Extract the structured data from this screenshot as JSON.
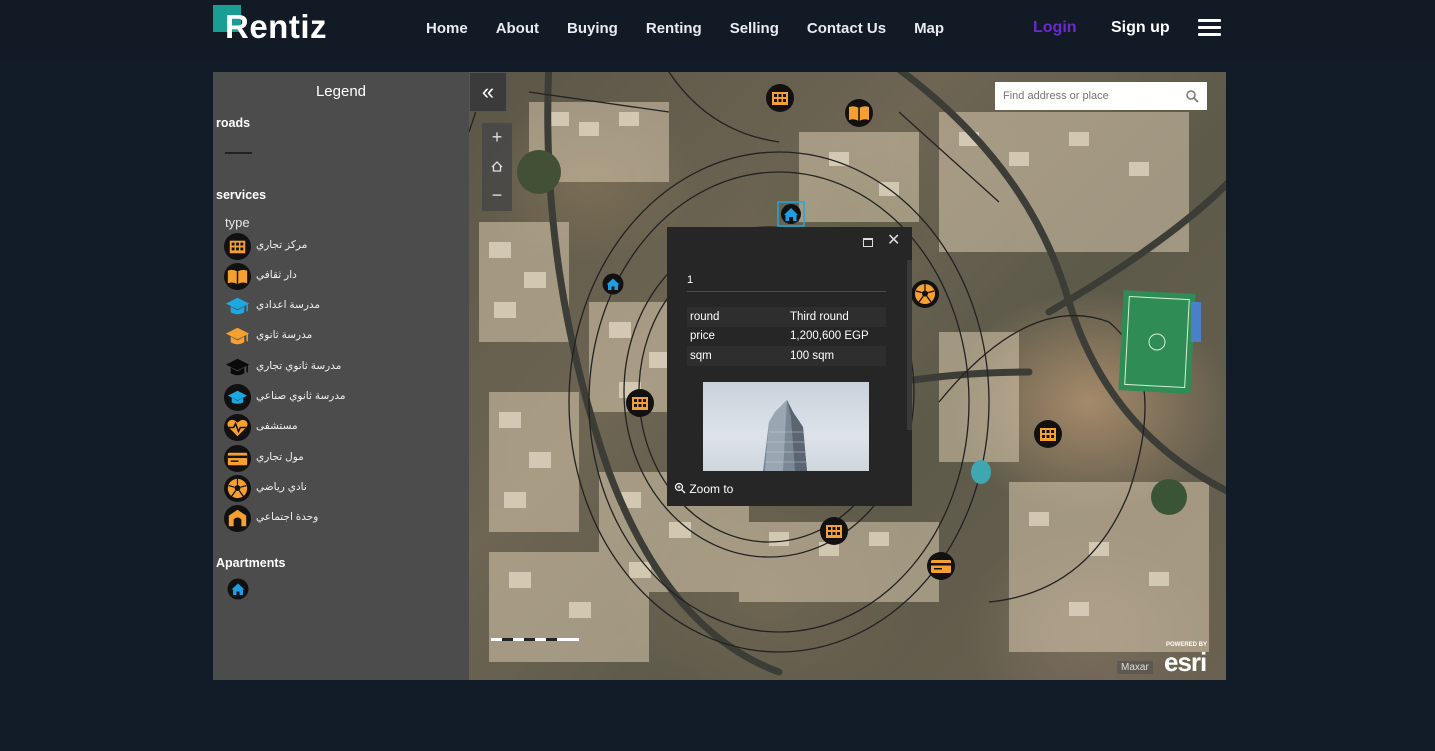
{
  "brand": {
    "name": "Rentiz",
    "accent": "#1a9e94"
  },
  "nav": {
    "links": [
      "Home",
      "About",
      "Buying",
      "Renting",
      "Selling",
      "Contact Us",
      "Map"
    ],
    "login": "Login",
    "signup": "Sign up",
    "login_color": "#6a2ad0",
    "menu_icon": "hamburger-icon"
  },
  "legend": {
    "title": "Legend",
    "roads_heading": "roads",
    "services_heading": "services",
    "services_sub": "type",
    "items": [
      {
        "label": "مركز تجاري",
        "icon": "shopping-center-icon"
      },
      {
        "label": "دار ثقافي",
        "icon": "book-icon"
      },
      {
        "label": "مدرسة اعدادي",
        "icon": "graduation-cap-blue-icon"
      },
      {
        "label": "مدرسة ثانوي",
        "icon": "graduation-cap-orange-icon"
      },
      {
        "label": "مدرسة ثانوي تجاري",
        "icon": "graduation-cap-black-icon"
      },
      {
        "label": "مدرسة ثانوي صناعي",
        "icon": "graduation-cap-circle-icon"
      },
      {
        "label": "مستشفى",
        "icon": "heart-pulse-icon"
      },
      {
        "label": "مول تجاري",
        "icon": "credit-card-icon"
      },
      {
        "label": "نادي رياضي",
        "icon": "soccer-ball-icon"
      },
      {
        "label": "وحدة اجتماعي",
        "icon": "community-unit-icon"
      }
    ],
    "apartments_heading": "Apartments",
    "apartment_icon": "apartment-home-icon"
  },
  "map": {
    "search_placeholder": "Find address or place",
    "collapse_label": "«",
    "zoom_in": "+",
    "zoom_out": "−",
    "attribution": "Maxar",
    "esri_small": "POWERED BY",
    "esri_big": "esri"
  },
  "popup": {
    "title": "1",
    "rows": [
      {
        "key": "round",
        "value": "Third round"
      },
      {
        "key": "price",
        "value": "1,200,600 EGP"
      },
      {
        "key": "sqm",
        "value": "100 sqm"
      }
    ],
    "zoom_label": "Zoom to"
  }
}
